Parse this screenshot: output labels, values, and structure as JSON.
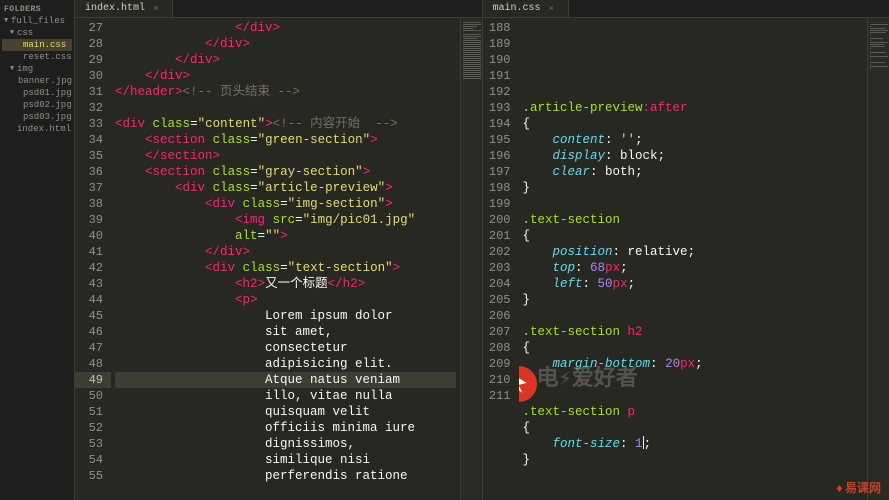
{
  "sidebar": {
    "header": "FOLDERS",
    "items": [
      {
        "label": "full_files",
        "arrow": "▼",
        "indent": 0
      },
      {
        "label": "css",
        "arrow": "▼",
        "indent": 1
      },
      {
        "label": "main.css",
        "arrow": "",
        "indent": 2,
        "selected": true
      },
      {
        "label": "reset.css",
        "arrow": "",
        "indent": 2
      },
      {
        "label": "img",
        "arrow": "▼",
        "indent": 1
      },
      {
        "label": "banner.jpg",
        "arrow": "",
        "indent": 2
      },
      {
        "label": "psd01.jpg",
        "arrow": "",
        "indent": 2
      },
      {
        "label": "psd02.jpg",
        "arrow": "",
        "indent": 2
      },
      {
        "label": "psd03.jpg",
        "arrow": "",
        "indent": 2
      },
      {
        "label": "index.html",
        "arrow": "",
        "indent": 1
      }
    ]
  },
  "leftEditor": {
    "tab": "index.html",
    "startLine": 27,
    "highlight": 49,
    "lines": [
      [
        [
          "                ",
          null
        ],
        [
          "</",
          1
        ],
        [
          "div",
          1
        ],
        [
          ">",
          1
        ]
      ],
      [
        [
          "            ",
          null
        ],
        [
          "</",
          1
        ],
        [
          "div",
          1
        ],
        [
          ">",
          1
        ]
      ],
      [
        [
          "        ",
          null
        ],
        [
          "</",
          1
        ],
        [
          "div",
          1
        ],
        [
          ">",
          1
        ]
      ],
      [
        [
          "    ",
          null
        ],
        [
          "</",
          1
        ],
        [
          "div",
          1
        ],
        [
          ">",
          1
        ]
      ],
      [
        [
          "",
          null
        ],
        [
          "</",
          1
        ],
        [
          "header",
          1
        ],
        [
          ">",
          1
        ],
        [
          "<!-- 页头结束 -->",
          4
        ]
      ],
      [
        [
          "",
          null
        ]
      ],
      [
        [
          "",
          null
        ],
        [
          "<",
          1
        ],
        [
          "div",
          1
        ],
        [
          " ",
          null
        ],
        [
          "class",
          2
        ],
        [
          "=",
          null
        ],
        [
          "\"content\"",
          3
        ],
        [
          ">",
          1
        ],
        [
          "<!-- 内容开始  -->",
          4
        ]
      ],
      [
        [
          "    ",
          null
        ],
        [
          "<",
          1
        ],
        [
          "section",
          1
        ],
        [
          " ",
          null
        ],
        [
          "class",
          2
        ],
        [
          "=",
          null
        ],
        [
          "\"green-section\"",
          3
        ],
        [
          ">",
          1
        ]
      ],
      [
        [
          "    ",
          null
        ],
        [
          "</",
          1
        ],
        [
          "section",
          1
        ],
        [
          ">",
          1
        ]
      ],
      [
        [
          "    ",
          null
        ],
        [
          "<",
          1
        ],
        [
          "section",
          1
        ],
        [
          " ",
          null
        ],
        [
          "class",
          2
        ],
        [
          "=",
          null
        ],
        [
          "\"gray-section\"",
          3
        ],
        [
          ">",
          1
        ]
      ],
      [
        [
          "        ",
          null
        ],
        [
          "<",
          1
        ],
        [
          "div",
          1
        ],
        [
          " ",
          null
        ],
        [
          "class",
          2
        ],
        [
          "=",
          null
        ],
        [
          "\"article-preview\"",
          3
        ],
        [
          ">",
          1
        ]
      ],
      [
        [
          "            ",
          null
        ],
        [
          "<",
          1
        ],
        [
          "div",
          1
        ],
        [
          " ",
          null
        ],
        [
          "class",
          2
        ],
        [
          "=",
          null
        ],
        [
          "\"img-section\"",
          3
        ],
        [
          ">",
          1
        ]
      ],
      [
        [
          "                ",
          null
        ],
        [
          "<",
          1
        ],
        [
          "img",
          1
        ],
        [
          " ",
          null
        ],
        [
          "src",
          2
        ],
        [
          "=",
          null
        ],
        [
          "\"img/pic01.jpg\"",
          3
        ],
        [
          " ",
          null
        ]
      ],
      [
        [
          "                ",
          null
        ],
        [
          "alt",
          2
        ],
        [
          "=",
          null
        ],
        [
          "\"\"",
          3
        ],
        [
          ">",
          1
        ]
      ],
      [
        [
          "            ",
          null
        ],
        [
          "</",
          1
        ],
        [
          "div",
          1
        ],
        [
          ">",
          1
        ]
      ],
      [
        [
          "            ",
          null
        ],
        [
          "<",
          1
        ],
        [
          "div",
          1
        ],
        [
          " ",
          null
        ],
        [
          "class",
          2
        ],
        [
          "=",
          null
        ],
        [
          "\"text-section\"",
          3
        ],
        [
          ">",
          1
        ]
      ],
      [
        [
          "                ",
          null
        ],
        [
          "<",
          1
        ],
        [
          "h2",
          1
        ],
        [
          ">",
          1
        ],
        [
          "又一个标题",
          5
        ],
        [
          "</",
          1
        ],
        [
          "h2",
          1
        ],
        [
          ">",
          1
        ]
      ],
      [
        [
          "                ",
          null
        ],
        [
          "<",
          1
        ],
        [
          "p",
          1
        ],
        [
          ">",
          1
        ]
      ],
      [
        [
          "                    ",
          null
        ],
        [
          "Lorem ipsum dolor",
          5
        ]
      ],
      [
        [
          "                    ",
          null
        ],
        [
          "sit amet,",
          5
        ]
      ],
      [
        [
          "                    ",
          null
        ],
        [
          "consectetur",
          5
        ]
      ],
      [
        [
          "                    ",
          null
        ],
        [
          "adipisicing elit.",
          5
        ]
      ],
      [
        [
          "                    ",
          null
        ],
        [
          "Atque natus veniam",
          5
        ]
      ],
      [
        [
          "                    ",
          null
        ],
        [
          "illo, vitae nulla",
          5
        ]
      ],
      [
        [
          "                    ",
          null
        ],
        [
          "quisquam velit",
          5
        ]
      ],
      [
        [
          "                    ",
          null
        ],
        [
          "officiis minima iure",
          5
        ]
      ],
      [
        [
          "                    ",
          null
        ],
        [
          "dignissimos,",
          5
        ]
      ],
      [
        [
          "                    ",
          null
        ],
        [
          "similique nisi",
          5
        ]
      ],
      [
        [
          "                    ",
          null
        ],
        [
          "perferendis ratione",
          5
        ]
      ]
    ]
  },
  "rightEditor": {
    "tab": "main.css",
    "startLine": 188,
    "cursorLine": 210,
    "lines": [
      [
        [
          "",
          null
        ]
      ],
      [
        [
          ".article-preview",
          6
        ],
        [
          ":after",
          7
        ]
      ],
      [
        [
          "{",
          8
        ]
      ],
      [
        [
          "    ",
          null
        ],
        [
          "content",
          9
        ],
        [
          ": ",
          null
        ],
        [
          "''",
          3
        ],
        [
          ";",
          null
        ]
      ],
      [
        [
          "    ",
          null
        ],
        [
          "display",
          9
        ],
        [
          ": ",
          null
        ],
        [
          "block",
          5
        ],
        [
          ";",
          null
        ]
      ],
      [
        [
          "    ",
          null
        ],
        [
          "clear",
          9
        ],
        [
          ": ",
          null
        ],
        [
          "both",
          5
        ],
        [
          ";",
          null
        ]
      ],
      [
        [
          "}",
          8
        ]
      ],
      [
        [
          "",
          null
        ]
      ],
      [
        [
          ".text-section",
          6
        ]
      ],
      [
        [
          "{",
          8
        ]
      ],
      [
        [
          "    ",
          null
        ],
        [
          "position",
          9
        ],
        [
          ": ",
          null
        ],
        [
          "relative",
          5
        ],
        [
          ";",
          null
        ]
      ],
      [
        [
          "    ",
          null
        ],
        [
          "top",
          9
        ],
        [
          ": ",
          null
        ],
        [
          "68",
          10
        ],
        [
          "px",
          11
        ],
        [
          ";",
          null
        ]
      ],
      [
        [
          "    ",
          null
        ],
        [
          "left",
          9
        ],
        [
          ": ",
          null
        ],
        [
          "50",
          10
        ],
        [
          "px",
          11
        ],
        [
          ";",
          null
        ]
      ],
      [
        [
          "}",
          8
        ]
      ],
      [
        [
          "",
          null
        ]
      ],
      [
        [
          ".text-section",
          6
        ],
        [
          " ",
          null
        ],
        [
          "h2",
          7
        ]
      ],
      [
        [
          "{",
          8
        ]
      ],
      [
        [
          "    ",
          null
        ],
        [
          "margin-bottom",
          9
        ],
        [
          ": ",
          null
        ],
        [
          "20",
          10
        ],
        [
          "px",
          11
        ],
        [
          ";",
          null
        ]
      ],
      [
        [
          "}",
          8
        ]
      ],
      [
        [
          "",
          null
        ]
      ],
      [
        [
          ".text-section",
          6
        ],
        [
          " ",
          null
        ],
        [
          "p",
          7
        ]
      ],
      [
        [
          "{",
          8
        ]
      ],
      [
        [
          "    ",
          null
        ],
        [
          "font-size",
          9
        ],
        [
          ": ",
          null
        ],
        [
          "1",
          10
        ],
        [
          "CURSOR",
          null
        ],
        [
          ";",
          null
        ]
      ],
      [
        [
          "}",
          8
        ]
      ]
    ]
  },
  "watermarkText": "电⚡爱好者",
  "footerBrand": "易课网"
}
